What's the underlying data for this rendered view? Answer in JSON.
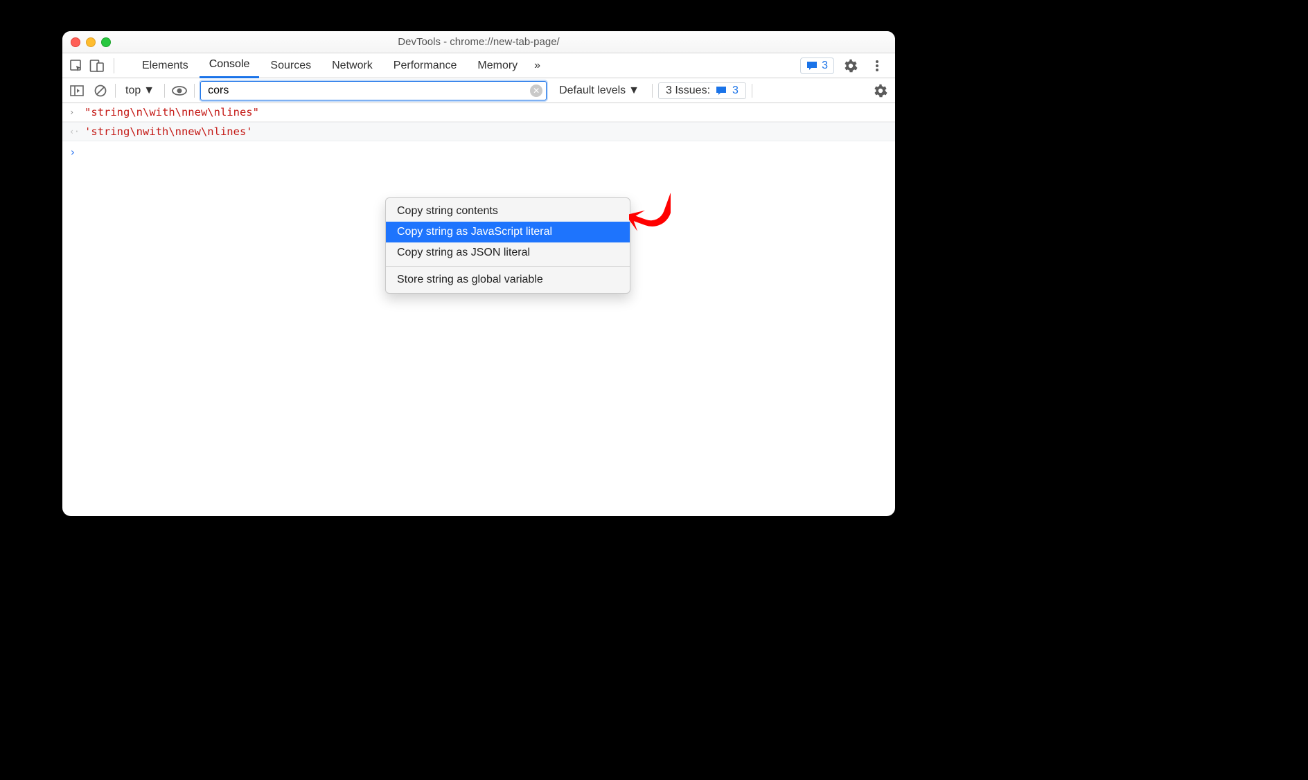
{
  "window": {
    "title": "DevTools - chrome://new-tab-page/"
  },
  "tabs": {
    "items": [
      "Elements",
      "Console",
      "Sources",
      "Network",
      "Performance",
      "Memory"
    ],
    "active": "Console",
    "overflow": "»",
    "messages_count": "3"
  },
  "toolbar": {
    "context": "top",
    "filter_value": "cors",
    "levels": "Default levels",
    "issues_label": "3 Issues:",
    "issues_count": "3"
  },
  "console": {
    "lines": [
      {
        "kind": "input",
        "text": "\"string\\n\\with\\nnew\\nlines\""
      },
      {
        "kind": "output",
        "text": "'string\\nwith\\nnew\\nlines'"
      }
    ]
  },
  "context_menu": {
    "items": [
      "Copy string contents",
      "Copy string as JavaScript literal",
      "Copy string as JSON literal"
    ],
    "separator_after": 2,
    "tail": [
      "Store string as global variable"
    ],
    "selected": "Copy string as JavaScript literal"
  }
}
